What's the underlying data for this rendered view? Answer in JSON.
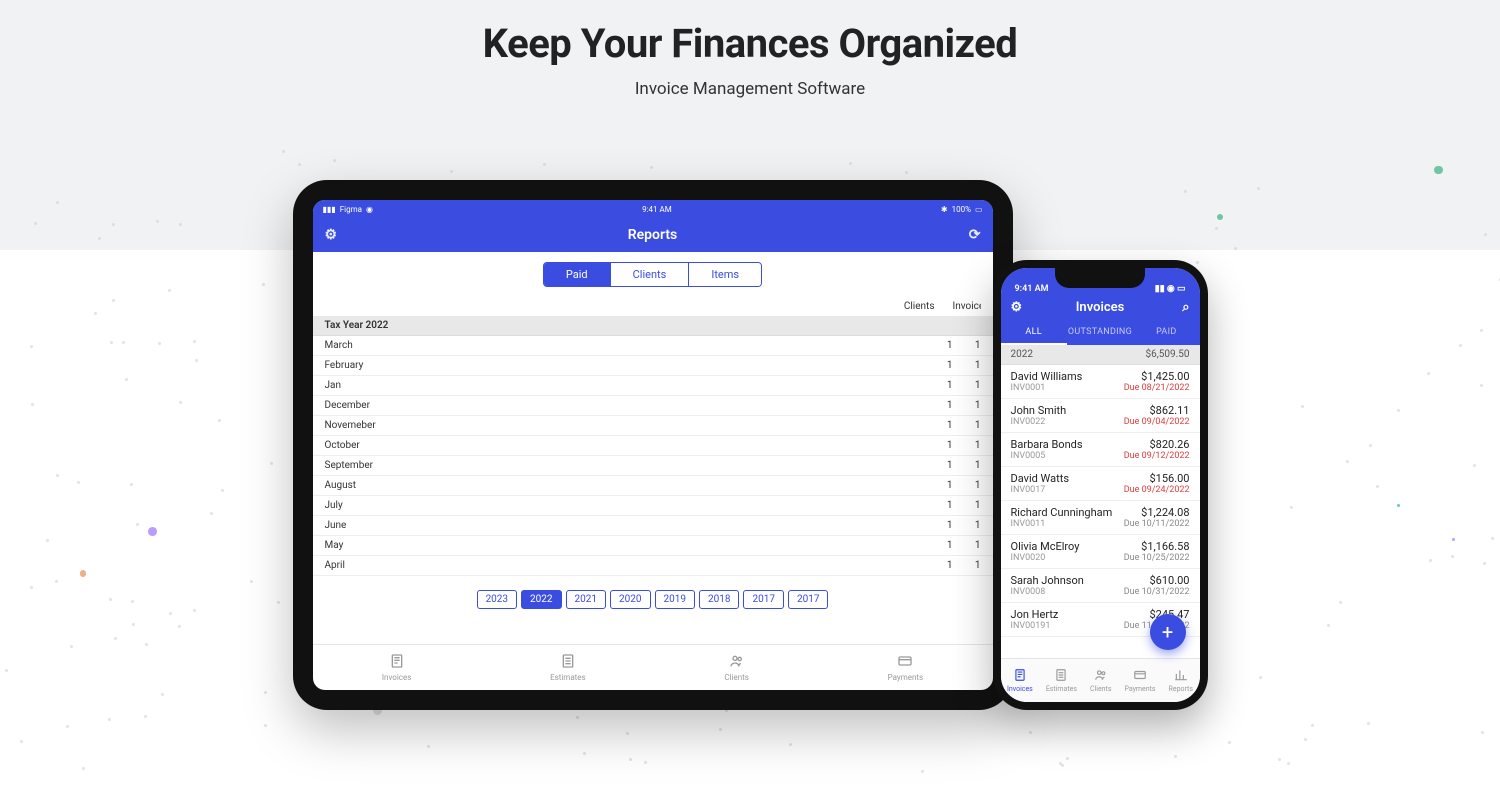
{
  "hero": {
    "title": "Keep Your Finances Organized",
    "subtitle": "Invoice Management Software"
  },
  "ipad": {
    "status": {
      "carrier": "Figma",
      "time": "9:41 AM",
      "battery": "100%"
    },
    "header": {
      "title": "Reports"
    },
    "segments": {
      "items": [
        "Paid",
        "Clients",
        "Items"
      ],
      "active": 0
    },
    "table": {
      "headers": [
        "Clients",
        "Invoices"
      ],
      "section": "Tax Year 2022",
      "rows": [
        {
          "label": "March",
          "clients": "1",
          "invoices": "1"
        },
        {
          "label": "February",
          "clients": "1",
          "invoices": "1"
        },
        {
          "label": "Jan",
          "clients": "1",
          "invoices": "1"
        },
        {
          "label": "December",
          "clients": "1",
          "invoices": "1"
        },
        {
          "label": "Novemeber",
          "clients": "1",
          "invoices": "1"
        },
        {
          "label": "October",
          "clients": "1",
          "invoices": "1"
        },
        {
          "label": "September",
          "clients": "1",
          "invoices": "1"
        },
        {
          "label": "August",
          "clients": "1",
          "invoices": "1"
        },
        {
          "label": "July",
          "clients": "1",
          "invoices": "1"
        },
        {
          "label": "June",
          "clients": "1",
          "invoices": "1"
        },
        {
          "label": "May",
          "clients": "1",
          "invoices": "1"
        },
        {
          "label": "April",
          "clients": "1",
          "invoices": "1"
        }
      ]
    },
    "years": {
      "items": [
        "2023",
        "2022",
        "2021",
        "2020",
        "2019",
        "2018",
        "2017",
        "2017"
      ],
      "active": 1
    },
    "tabbar": [
      "Invoices",
      "Estimates",
      "Clients",
      "Payments"
    ]
  },
  "iphone": {
    "status": {
      "time": "9:41 AM"
    },
    "header": {
      "title": "Invoices"
    },
    "tabs": {
      "items": [
        "ALL",
        "OUTSTANDING",
        "PAID"
      ],
      "active": 0
    },
    "summary": {
      "year": "2022",
      "total": "$6,509.50"
    },
    "invoices": [
      {
        "name": "David Williams",
        "num": "INV0001",
        "amt": "$1,425.00",
        "due": "Due 08/21/2022",
        "overdue": true
      },
      {
        "name": "John Smith",
        "num": "INV0022",
        "amt": "$862.11",
        "due": "Due 09/04/2022",
        "overdue": true
      },
      {
        "name": "Barbara Bonds",
        "num": "INV0005",
        "amt": "$820.26",
        "due": "Due 09/12/2022",
        "overdue": true
      },
      {
        "name": "David Watts",
        "num": "INV0017",
        "amt": "$156.00",
        "due": "Due 09/24/2022",
        "overdue": true
      },
      {
        "name": "Richard Cunningham",
        "num": "INV0011",
        "amt": "$1,224.08",
        "due": "Due 10/11/2022",
        "overdue": false
      },
      {
        "name": "Olivia McElroy",
        "num": "INV0020",
        "amt": "$1,166.58",
        "due": "Due 10/25/2022",
        "overdue": false
      },
      {
        "name": "Sarah Johnson",
        "num": "INV0008",
        "amt": "$610.00",
        "due": "Due 10/31/2022",
        "overdue": false
      },
      {
        "name": "Jon Hertz",
        "num": "INV00191",
        "amt": "$245.47",
        "due": "Due 11/01/2022",
        "overdue": false
      }
    ],
    "tabbar": [
      "Invoices",
      "Estimates",
      "Clients",
      "Payments",
      "Reports"
    ]
  }
}
